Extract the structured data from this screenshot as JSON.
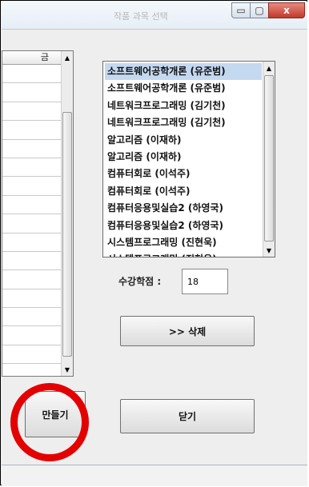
{
  "window": {
    "title": "작품 과목 선택",
    "controls": {
      "minimize": "▭",
      "maximize": "▢",
      "close": "x"
    }
  },
  "table": {
    "header": "금",
    "row_count": 17
  },
  "course_list": {
    "items": [
      "소프트웨어공학개론 (유준범)",
      "소프트웨어공학개론 (유준범)",
      "네트워크프로그래밍 (김기천)",
      "네트워크프로그래밍 (김기천)",
      "알고리즘 (이재하)",
      "알고리즘 (이재하)",
      "컴퓨터회로 (이석주)",
      "컴퓨터회로 (이석주)",
      "컴퓨터응용및실습2 (하영국)",
      "컴퓨터응용및실습2 (하영국)",
      "시스템프로그래밍 (진현욱)",
      "시스템프로그래밍 (진현욱)"
    ],
    "selected_index": 0
  },
  "credits": {
    "label": "수강학점 :",
    "value": "18"
  },
  "buttons": {
    "delete": ">> 삭제",
    "make": "만들기",
    "close": "닫기"
  },
  "colors": {
    "highlight": "#e30000",
    "selection": "#c4d9f0"
  }
}
